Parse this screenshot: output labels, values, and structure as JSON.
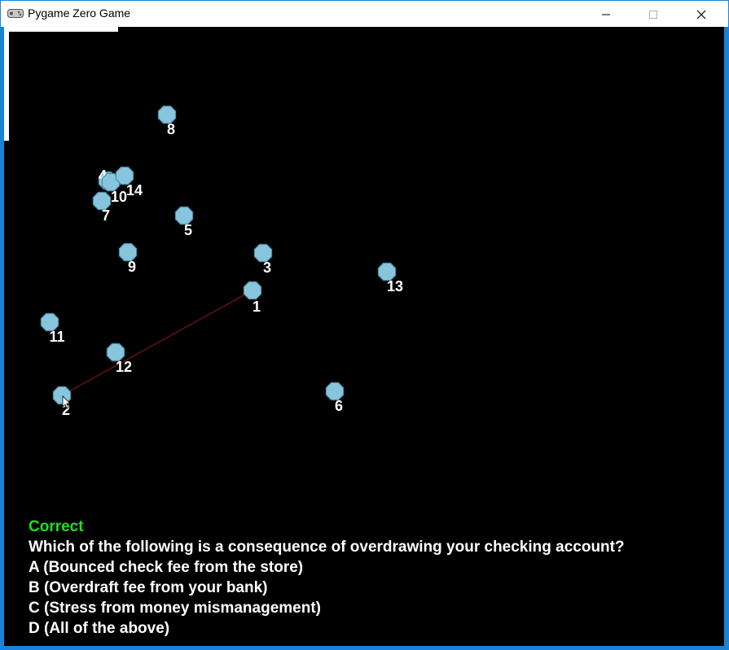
{
  "window": {
    "title": "Pygame Zero Game",
    "icon": "gamepad-icon"
  },
  "colors": {
    "node_fill": "#87c5dc",
    "node_stroke": "#4f8aa3",
    "line": "#7a1515",
    "feedback": "#1ee01e",
    "text": "#ffffff",
    "background": "#000000"
  },
  "nodes": [
    {
      "id": "1",
      "label": "1"
    },
    {
      "id": "2",
      "label": "2"
    },
    {
      "id": "3",
      "label": "3"
    },
    {
      "id": "4",
      "label": "4"
    },
    {
      "id": "5",
      "label": "5"
    },
    {
      "id": "6",
      "label": "6"
    },
    {
      "id": "7",
      "label": "7"
    },
    {
      "id": "8",
      "label": "8"
    },
    {
      "id": "9",
      "label": "9"
    },
    {
      "id": "10",
      "label": "10"
    },
    {
      "id": "11",
      "label": "11"
    },
    {
      "id": "12",
      "label": "12"
    },
    {
      "id": "13",
      "label": "13"
    },
    {
      "id": "14",
      "label": "14"
    }
  ],
  "links": [
    {
      "from": "1",
      "to": "2"
    }
  ],
  "quiz": {
    "feedback": "Correct",
    "question": "Which of the following is a consequence of overdrawing your checking account?",
    "options": [
      "A (Bounced check fee from the store)",
      "B (Overdraft fee from your bank)",
      "C (Stress from money mismanagement)",
      "D (All of the above)"
    ]
  }
}
